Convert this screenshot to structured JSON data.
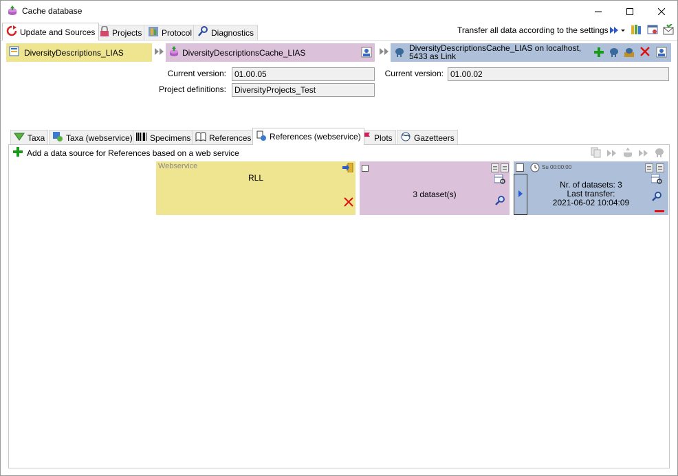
{
  "window": {
    "title": "Cache database"
  },
  "main_tabs": [
    {
      "label": "Update and Sources",
      "icon": "refresh-icon",
      "active": true
    },
    {
      "label": "Projects",
      "icon": "lock-icon",
      "active": false
    },
    {
      "label": "Protocol",
      "icon": "protocol-icon",
      "active": false
    },
    {
      "label": "Diagnostics",
      "icon": "stethoscope-icon",
      "active": false
    }
  ],
  "toolbar": {
    "transfer_all_label": "Transfer all data according to the settings"
  },
  "source_db": {
    "name": "DiversityDescriptions_LIAS",
    "current_version_label": "Current version:",
    "current_version": "01.00.05",
    "project_definitions_label": "Project definitions:",
    "project_definitions": "DiversityProjects_Test"
  },
  "cache_db": {
    "name": "DiversityDescriptionsCache_LIAS"
  },
  "postgres_db": {
    "name": "DiversityDescriptionsCache_LIAS on localhost, 5433 as Link",
    "current_version_label": "Current version:",
    "current_version": "01.00.02"
  },
  "sub_tabs": [
    {
      "label": "Taxa",
      "icon": "taxa-icon",
      "active": false
    },
    {
      "label": "Taxa (webservice)",
      "icon": "taxa-webservice-icon",
      "active": false
    },
    {
      "label": "Specimens",
      "icon": "barcode-icon",
      "active": false
    },
    {
      "label": "References",
      "icon": "book-icon",
      "active": false
    },
    {
      "label": "References (webservice)",
      "icon": "references-webservice-icon",
      "active": true
    },
    {
      "label": "Plots",
      "icon": "plots-icon",
      "active": false
    },
    {
      "label": "Gazetteers",
      "icon": "globe-icon",
      "active": false
    }
  ],
  "references_ws": {
    "add_label": "Add a data source for References based on a web service",
    "webservice_caption": "Webservice",
    "webservice_name": "RLL",
    "cache_datasets": "3 dataset(s)",
    "schedule_label": "Su 00:00:00",
    "pg_nr_datasets": "Nr. of datasets: 3",
    "pg_last_transfer_label": "Last transfer:",
    "pg_last_transfer": "2021-06-02 10:04:09"
  },
  "colors": {
    "source_yellow": "#efe590",
    "cache_purple": "#dbc1da",
    "postgres_blue": "#aebfd9",
    "add_green": "#1a9a1a",
    "delete_red": "#e01010"
  }
}
